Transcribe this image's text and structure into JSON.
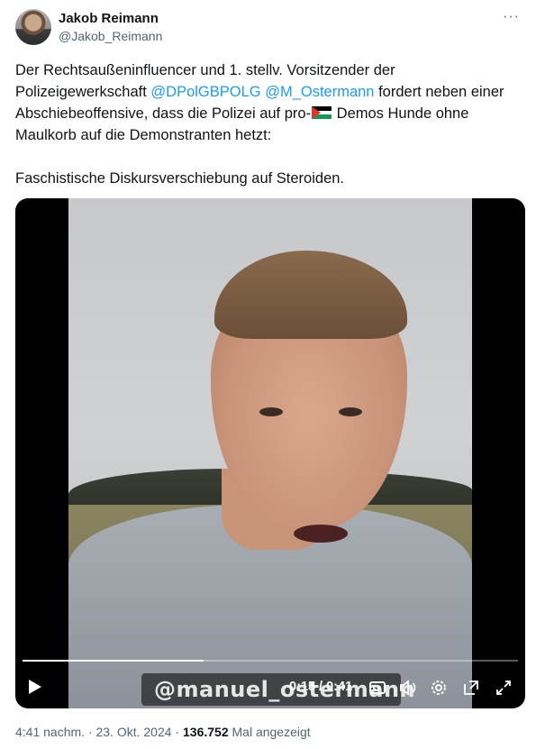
{
  "author": {
    "name": "Jakob Reimann",
    "handle": "@Jakob_Reimann"
  },
  "menu": {
    "more_label": "···"
  },
  "tweet": {
    "line1": "Der Rechtsaußeninfluencer und 1. stellv. Vorsitzender der",
    "line2_prefix": "Polizeigewerkschaft ",
    "mention1": "@DPolGBPOLG",
    "mention2": "@M_Ostermann",
    "line2_suffix": " fordert neben einer",
    "line3_prefix": "Abschiebeoffensive, dass die Polizei auf pro-",
    "line3_suffix": " Demos Hunde ohne",
    "line4": "Maulkorb auf die Demonstranten hetzt:",
    "line6": "Faschistische Diskursverschiebung auf Steroiden.",
    "flag_icon": "palestine-flag-emoji"
  },
  "video": {
    "watermark": "@manuel_ostermann",
    "time": "0:15 / 0:41",
    "progress": 0.366,
    "icons": [
      "play-icon",
      "captions-icon",
      "volume-icon",
      "settings-icon",
      "pip-icon",
      "popout-icon",
      "fullscreen-icon"
    ]
  },
  "meta": {
    "timestamp": "4:41 nachm. · 23. Okt. 2024 · ",
    "views": "136.752",
    "views_label": " Mal angezeigt"
  }
}
